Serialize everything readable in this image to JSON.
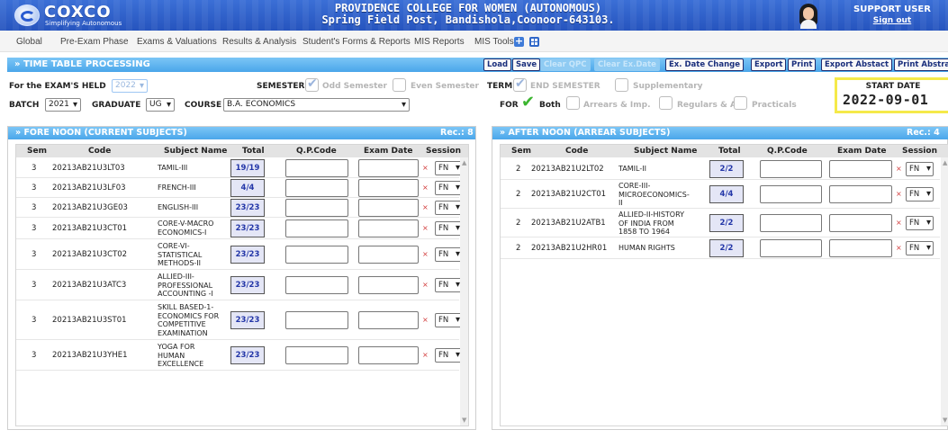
{
  "header": {
    "logo_name": "COXCO",
    "logo_tagline": "Simplifying Autonomous",
    "college_line1": "PROVIDENCE COLLEGE FOR WOMEN (AUTONOMOUS)",
    "college_line2": "Spring Field Post, Bandishola,Coonoor-643103.",
    "user_name": "SUPPORT USER",
    "sign_out": "Sign out",
    "colors": {
      "bar": "#2d5ec8",
      "panel_head": "#5ab2ef",
      "accent_text": "#1a2f7c"
    }
  },
  "menu": {
    "items": [
      "Global",
      "Pre-Exam Phase",
      "Exams & Valuations",
      "Results & Analysis",
      "Student's Forms & Reports",
      "MIS Reports",
      "MIS Tools"
    ],
    "icons": [
      "plus-icon",
      "grid-icon"
    ]
  },
  "process": {
    "title": "» TIME TABLE PROCESSING",
    "buttons": {
      "load": "Load",
      "save": "Save",
      "clear_qpc": "Clear QPC",
      "clear_ex_date": "Clear Ex.Date",
      "ex_date_change": "Ex. Date Change",
      "export": "Export",
      "print": "Print",
      "export_abstact": "Export Abstact",
      "print_abstract": "Print Abstra"
    }
  },
  "form": {
    "exam_held_label": "For the EXAM'S HELD",
    "exam_held_value": "2022",
    "semester_label": "SEMESTER",
    "odd_semester": "Odd Semester",
    "even_semester": "Even Semester",
    "term_label": "TERM",
    "end_semester": "END SEMESTER",
    "supplementary": "Supplementary",
    "batch_label": "BATCH",
    "batch_value": "2021",
    "graduate_label": "GRADUATE",
    "graduate_value": "UG",
    "course_label": "COURSE",
    "course_value": "B.A. ECONOMICS",
    "for_label": "FOR",
    "both": "Both",
    "arrears": "Arrears & Imp.",
    "regulars": "Regulars & ALC",
    "practicals": "Practicals",
    "start_date_label": "START DATE",
    "start_date_value": "2022-09-01"
  },
  "fore_noon": {
    "title": "» FORE NOON (CURRENT SUBJECTS)",
    "rec": "Rec.: 8",
    "columns": [
      "Sem",
      "Code",
      "Subject Name",
      "Total",
      "Q.P.Code",
      "Exam Date",
      "Session"
    ],
    "rows": [
      {
        "sem": "3",
        "code": "20213AB21U3LT03",
        "subject": "TAMIL-III",
        "total": "19/19",
        "session": "FN"
      },
      {
        "sem": "3",
        "code": "20213AB21U3LF03",
        "subject": "FRENCH-III",
        "total": "4/4",
        "session": "FN"
      },
      {
        "sem": "3",
        "code": "20213AB21U3GE03",
        "subject": "ENGLISH-III",
        "total": "23/23",
        "session": "FN"
      },
      {
        "sem": "3",
        "code": "20213AB21U3CT01",
        "subject": "CORE-V-MACRO\nECONOMICS-I",
        "total": "23/23",
        "session": "FN"
      },
      {
        "sem": "3",
        "code": "20213AB21U3CT02",
        "subject": "CORE-VI-\nSTATISTICAL\nMETHODS-II",
        "total": "23/23",
        "session": "FN"
      },
      {
        "sem": "3",
        "code": "20213AB21U3ATC3",
        "subject": "ALLIED-III-\nPROFESSIONAL\nACCOUNTING -I",
        "total": "23/23",
        "session": "FN"
      },
      {
        "sem": "3",
        "code": "20213AB21U3ST01",
        "subject": "SKILL BASED-1-\nECONOMICS FOR\nCOMPETITIVE\nEXAMINATION",
        "total": "23/23",
        "session": "FN"
      },
      {
        "sem": "3",
        "code": "20213AB21U3YHE1",
        "subject": "YOGA FOR\nHUMAN\nEXCELLENCE",
        "total": "23/23",
        "session": "FN"
      }
    ]
  },
  "after_noon": {
    "title": "» AFTER NOON (ARREAR SUBJECTS)",
    "rec": "Rec.: 4",
    "columns": [
      "Sem",
      "Code",
      "Subject Name",
      "Total",
      "Q.P.Code",
      "Exam Date",
      "Session"
    ],
    "rows": [
      {
        "sem": "2",
        "code": "20213AB21U2LT02",
        "subject": "TAMIL-II",
        "total": "2/2",
        "session": "FN"
      },
      {
        "sem": "2",
        "code": "20213AB21U2CT01",
        "subject": "CORE-III-\nMICROECONOMICS-\nII",
        "total": "4/4",
        "session": "FN"
      },
      {
        "sem": "2",
        "code": "20213AB21U2ATB1",
        "subject": "ALLIED-II-HISTORY\nOF INDIA FROM\n1858 TO 1964",
        "total": "2/2",
        "session": "FN"
      },
      {
        "sem": "2",
        "code": "20213AB21U2HR01",
        "subject": "HUMAN RIGHTS",
        "total": "2/2",
        "session": "FN"
      }
    ]
  }
}
